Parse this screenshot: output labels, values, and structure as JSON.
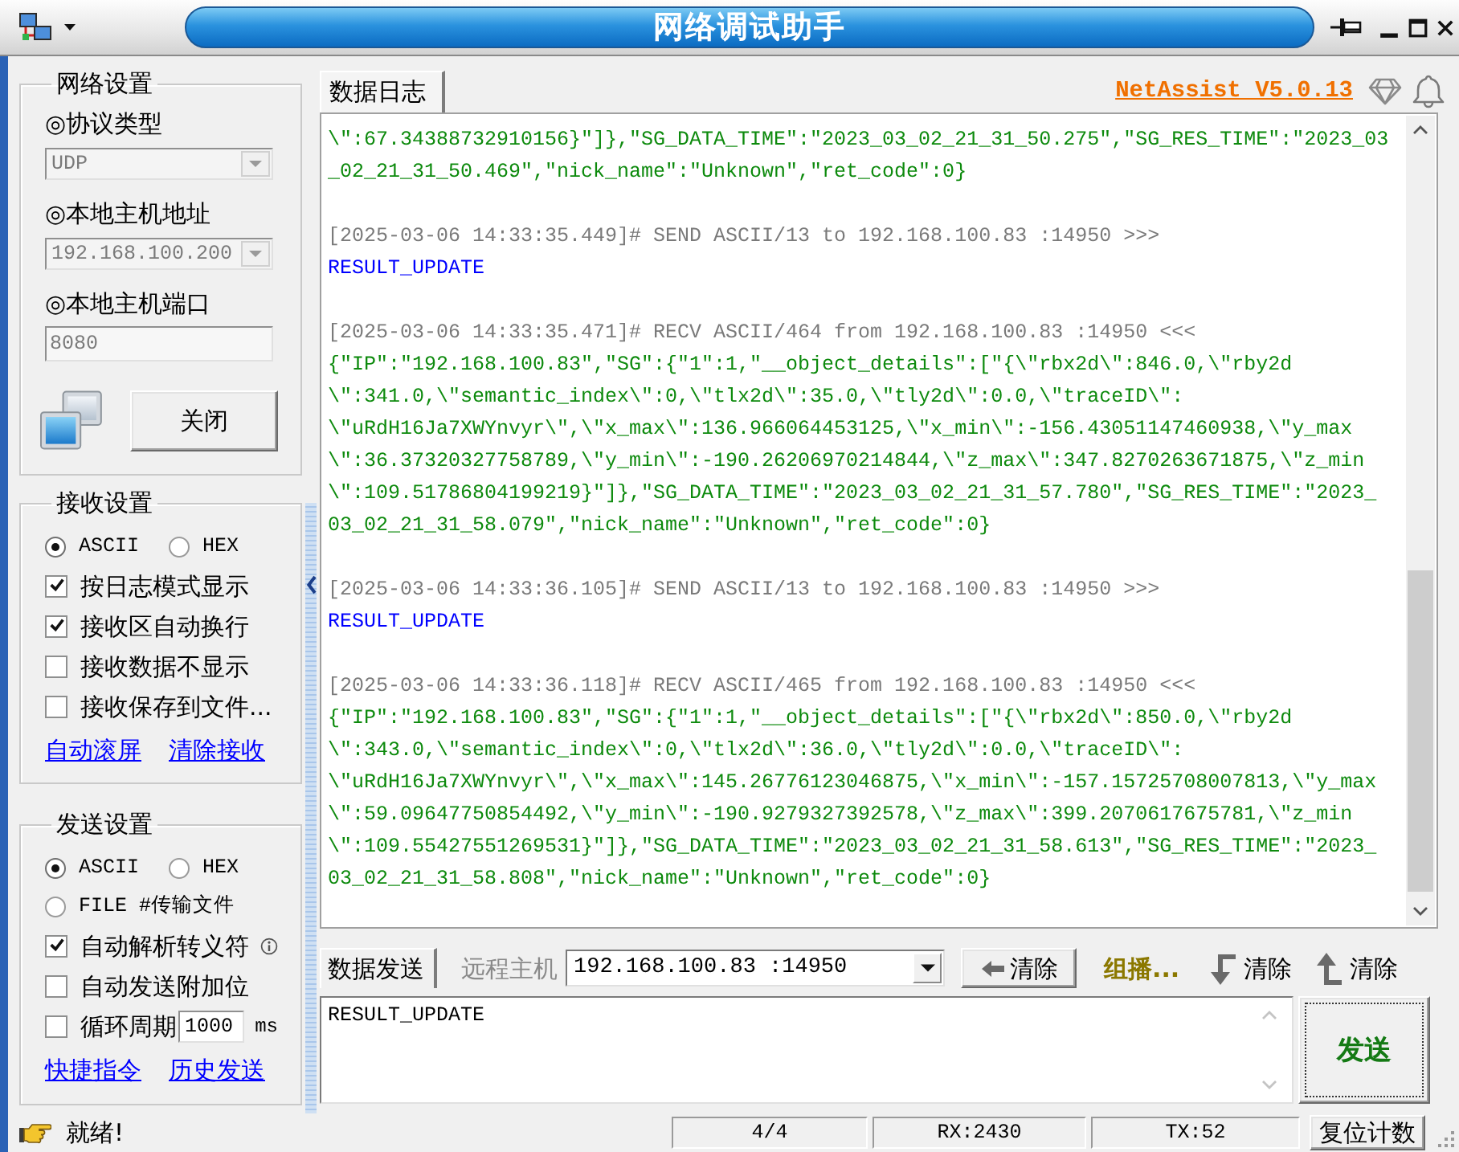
{
  "window": {
    "title": "网络调试助手"
  },
  "network_settings": {
    "title": "网络设置",
    "fields": [
      {
        "label": "◎协议类型",
        "kind": "select",
        "value": "UDP",
        "disabled": true
      },
      {
        "label": "◎本地主机地址",
        "kind": "select",
        "value": "192.168.100.200",
        "disabled": true
      },
      {
        "label": "◎本地主机端口",
        "kind": "input",
        "value": "8080",
        "disabled": true
      }
    ],
    "connect_button": "关闭"
  },
  "receive_settings": {
    "title": "接收设置",
    "encodings": [
      {
        "label": "ASCII",
        "selected": true
      },
      {
        "label": "HEX",
        "selected": false
      }
    ],
    "options": [
      {
        "label": "按日志模式显示",
        "checked": true
      },
      {
        "label": "接收区自动换行",
        "checked": true
      },
      {
        "label": "接收数据不显示",
        "checked": false
      },
      {
        "label": "接收保存到文件...",
        "checked": false
      }
    ],
    "links": [
      "自动滚屏",
      "清除接收"
    ]
  },
  "send_settings": {
    "title": "发送设置",
    "encodings": [
      {
        "label": "ASCII",
        "selected": true
      },
      {
        "label": "HEX",
        "selected": false
      },
      {
        "label": "FILE #传输文件",
        "selected": false
      }
    ],
    "options": [
      {
        "kind": "info",
        "label": "自动解析转义符",
        "checked": true
      },
      {
        "kind": "plain",
        "label": "自动发送附加位",
        "checked": false
      },
      {
        "kind": "period",
        "label": "循环周期",
        "checked": false,
        "period": "1000",
        "unit": "ms"
      }
    ],
    "links": [
      "快捷指令",
      "历史发送"
    ]
  },
  "log_panel": {
    "tab": {
      "label": "数据日志",
      "selected": true
    },
    "version_link": "NetAssist V5.0.13",
    "entries": [
      {
        "kind": "recv",
        "lines": [
          "\\\":67.34388732910156}\"]},\"SG_DATA_TIME\":\"2023_03_02_21_31_50.275\",\"SG_RES_TIME\":\"2023_03",
          "_02_21_31_50.469\",\"nick_name\":\"Unknown\",\"ret_code\":0}"
        ]
      },
      {
        "kind": "send",
        "header": "[2025-03-06 14:33:35.449]# SEND ASCII/13 to 192.168.100.83 :14950 >>>",
        "lines": [
          "RESULT_UPDATE"
        ]
      },
      {
        "kind": "recv",
        "header": "[2025-03-06 14:33:35.471]# RECV ASCII/464 from 192.168.100.83 :14950 <<<",
        "lines": [
          "{\"IP\":\"192.168.100.83\",\"SG\":{\"1\":1,\"__object_details\":[\"{\\\"rbx2d\\\":846.0,\\\"rby2d",
          "\\\":341.0,\\\"semantic_index\\\":0,\\\"tlx2d\\\":35.0,\\\"tly2d\\\":0.0,\\\"traceID\\\":",
          "\\\"uRdH16Ja7XWYnvyr\\\",\\\"x_max\\\":136.966064453125,\\\"x_min\\\":-156.43051147460938,\\\"y_max",
          "\\\":36.37320327758789,\\\"y_min\\\":-190.26206970214844,\\\"z_max\\\":347.8270263671875,\\\"z_min",
          "\\\":109.51786804199219}\"]},\"SG_DATA_TIME\":\"2023_03_02_21_31_57.780\",\"SG_RES_TIME\":\"2023_",
          "03_02_21_31_58.079\",\"nick_name\":\"Unknown\",\"ret_code\":0}"
        ]
      },
      {
        "kind": "send",
        "header": "[2025-03-06 14:33:36.105]# SEND ASCII/13 to 192.168.100.83 :14950 >>>",
        "lines": [
          "RESULT_UPDATE"
        ]
      },
      {
        "kind": "recv",
        "header": "[2025-03-06 14:33:36.118]# RECV ASCII/465 from 192.168.100.83 :14950 <<<",
        "lines": [
          "{\"IP\":\"192.168.100.83\",\"SG\":{\"1\":1,\"__object_details\":[\"{\\\"rbx2d\\\":850.0,\\\"rby2d",
          "\\\":343.0,\\\"semantic_index\\\":0,\\\"tlx2d\\\":36.0,\\\"tly2d\\\":0.0,\\\"traceID\\\":",
          "\\\"uRdH16Ja7XWYnvyr\\\",\\\"x_max\\\":145.26776123046875,\\\"x_min\\\":-157.15725708007813,\\\"y_max",
          "\\\":59.09647750854492,\\\"y_min\\\":-190.9279327392578,\\\"z_max\\\":399.2070617675781,\\\"z_min",
          "\\\":109.55427551269531}\"]},\"SG_DATA_TIME\":\"2023_03_02_21_31_58.613\",\"SG_RES_TIME\":\"2023_",
          "03_02_21_31_58.808\",\"nick_name\":\"Unknown\",\"ret_code\":0}"
        ]
      }
    ]
  },
  "send_panel": {
    "tab": {
      "label": "数据发送",
      "selected": true
    },
    "remote_host_label": "远程主机",
    "remote_host": "192.168.100.83 :14950",
    "clear_button": "清除",
    "multicast_link": "组播...",
    "clear_rx_button": "清除",
    "clear_tx_button": "清除",
    "message": "RESULT_UPDATE",
    "send_button": "发送"
  },
  "status_bar": {
    "message": "就绪!",
    "counter": "4/4",
    "rx": "RX:2430",
    "tx": "TX:52",
    "reset_button": "复位计数"
  }
}
